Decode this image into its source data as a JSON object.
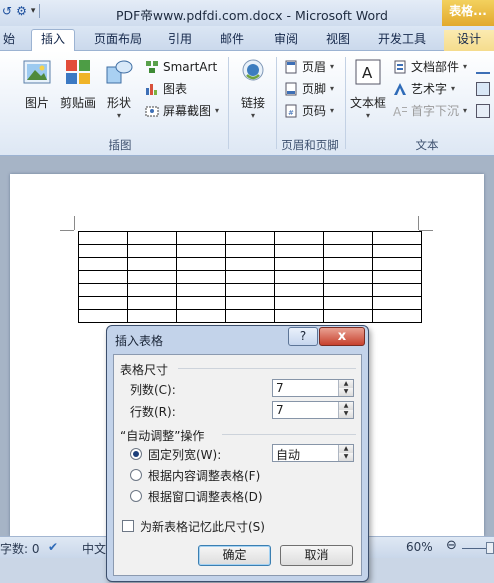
{
  "window": {
    "title": "PDF帝www.pdfdi.com.docx - Microsoft Word",
    "context_tab_title": "表格..."
  },
  "tabs": [
    {
      "label": "始"
    },
    {
      "label": "插入"
    },
    {
      "label": "页面布局"
    },
    {
      "label": "引用"
    },
    {
      "label": "邮件"
    },
    {
      "label": "审阅"
    },
    {
      "label": "视图"
    },
    {
      "label": "开发工具"
    },
    {
      "label": "设计"
    }
  ],
  "ribbon": {
    "illustrations": {
      "picture": "图片",
      "clipart": "剪贴画",
      "shapes": "形状",
      "smartart": "SmartArt",
      "chart": "图表",
      "screenshot": "屏幕截图",
      "group_label": "插图"
    },
    "links": {
      "link": "链接"
    },
    "header_footer": {
      "header": "页眉",
      "footer": "页脚",
      "page_number": "页码",
      "group_label": "页眉和页脚"
    },
    "text": {
      "textbox": "文本框",
      "quick_parts": "文档部件",
      "wordart": "艺术字",
      "drop_cap": "首字下沉",
      "group_label": "文本"
    }
  },
  "document": {
    "table": {
      "rows": 7,
      "cols": 7
    }
  },
  "statusbar": {
    "word_count": "字数: 0",
    "language": "中文",
    "zoom": "60%"
  },
  "dialog": {
    "title": "插入表格",
    "help": "?",
    "close": "x",
    "size_section": "表格尺寸",
    "columns_label": "列数(C):",
    "columns_value": "7",
    "rows_label": "行数(R):",
    "rows_value": "7",
    "autofit_section": "“自动调整”操作",
    "fixed_width": "固定列宽(W):",
    "fixed_width_value": "自动",
    "fit_content": "根据内容调整表格(F)",
    "fit_window": "根据窗口调整表格(D)",
    "remember": "为新表格记忆此尺寸(S)",
    "ok": "确定",
    "cancel": "取消"
  }
}
